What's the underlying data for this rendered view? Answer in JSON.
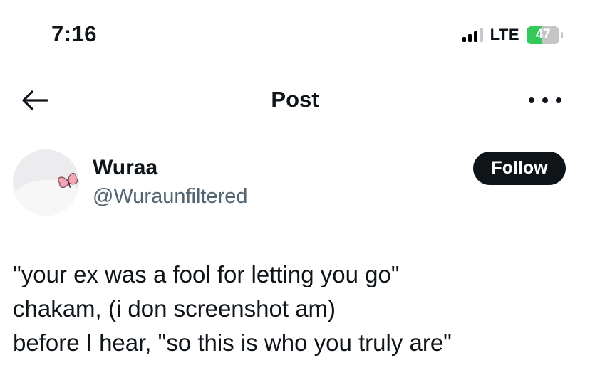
{
  "status_bar": {
    "time": "7:16",
    "network": "LTE",
    "battery": "47",
    "battery_level_percent": 47,
    "battery_color": "#34c759"
  },
  "header": {
    "title": "Post",
    "back_icon": "arrow-left-icon",
    "more_icon": "more-horizontal-icon"
  },
  "author": {
    "name": "Wuraa",
    "handle": "@Wuraunfiltered",
    "avatar_icon": "butterfly-icon"
  },
  "follow_button": {
    "label": "Follow"
  },
  "post": {
    "lines": [
      "\"your ex was a fool for letting you go\"",
      "chakam, (i don screenshot am)",
      "before I hear, \"so this is who you truly are\""
    ]
  }
}
